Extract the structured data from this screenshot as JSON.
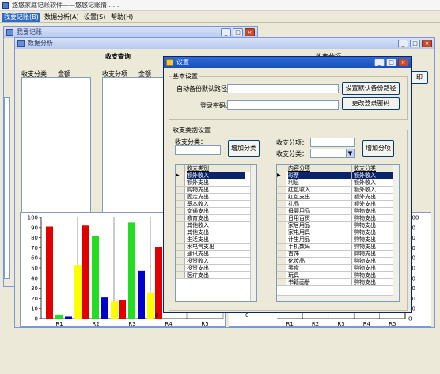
{
  "app": {
    "title": "悠悠家庭记账软件——悠悠记账情......"
  },
  "menu": [
    "我要记账(B)",
    "数据分析(A)",
    "设置(S)",
    "帮助(H)"
  ],
  "win_bookkeeping": {
    "title": "我要记账"
  },
  "win_analysis": {
    "title": "数据分析",
    "query_title": "收支查询",
    "list1_headers": [
      "收支分类",
      "金额"
    ],
    "list2_headers": [
      "收支分项",
      "金额"
    ],
    "right_title": "收支分项",
    "right_button": "印",
    "right_label": "收支"
  },
  "settings": {
    "title": "设置",
    "basic_group": "基本设置",
    "backup_path_label": "自动备份默认路径：",
    "backup_path_value": "",
    "password_label": "登录密码：",
    "password_value": "",
    "set_backup_button": "设置默认备份路径",
    "change_password_button": "更改登录密码",
    "category_group": "收支类别设置",
    "category_label": "收支分类：",
    "add_category_button": "增加分类",
    "item_label": "收支分项：",
    "item_category_label": "收支分类：",
    "add_item_button": "增加分项",
    "grid1": {
      "header": "收支类别",
      "rows": [
        "额外收入",
        "额外支出",
        "购物支出",
        "固定支出",
        "基本收入",
        "交通支出",
        "教育支出",
        "其他收入",
        "其他支出",
        "生活支出",
        "水电气支出",
        "通讯支出",
        "投资收入",
        "投资支出",
        "医疗支出"
      ]
    },
    "grid2": {
      "headers": [
        "内容分项",
        "收支分类"
      ],
      "rows": [
        [
          "彩票",
          "额外收入"
        ],
        [
          "利息",
          "额外收入"
        ],
        [
          "红包收入",
          "额外收入"
        ],
        [
          "红包支出",
          "额外支出"
        ],
        [
          "礼品",
          "额外支出"
        ],
        [
          "母婴用品",
          "购物支出"
        ],
        [
          "日用百货",
          "购物支出"
        ],
        [
          "家居用品",
          "购物支出"
        ],
        [
          "家电用具",
          "购物支出"
        ],
        [
          "计生用品",
          "购物支出"
        ],
        [
          "手机数码",
          "购物支出"
        ],
        [
          "首饰",
          "购物支出"
        ],
        [
          "化妆品",
          "购物支出"
        ],
        [
          "零食",
          "购物支出"
        ],
        [
          "玩具",
          "购物支出"
        ],
        [
          "书籍画册",
          "购物支出"
        ]
      ]
    }
  },
  "chart_data": {
    "type": "bar",
    "categories": [
      "R1",
      "R2",
      "R3",
      "R4",
      "R5"
    ],
    "series": [
      {
        "color": "#e00000",
        "values": [
          91,
          92,
          18,
          71,
          0
        ]
      },
      {
        "color": "#22dd22",
        "values": [
          4,
          82,
          95,
          0,
          0
        ]
      },
      {
        "color": "#0000cc",
        "values": [
          2,
          21,
          47,
          0,
          0
        ]
      },
      {
        "color": "#ffff00",
        "values": [
          53,
          17,
          26,
          0,
          0
        ]
      }
    ],
    "y_ticks": [
      0,
      10,
      20,
      30,
      40,
      50,
      60,
      70,
      80,
      90,
      100
    ],
    "ylim": [
      0,
      100
    ],
    "zero_labels": [
      "0",
      "0"
    ],
    "right_chart": {
      "categories": [
        "R1",
        "R2",
        "R3",
        "R4",
        "R5"
      ],
      "y_ticks": [
        0,
        10,
        20,
        30,
        40,
        50,
        60,
        70,
        80,
        90,
        100
      ]
    }
  }
}
